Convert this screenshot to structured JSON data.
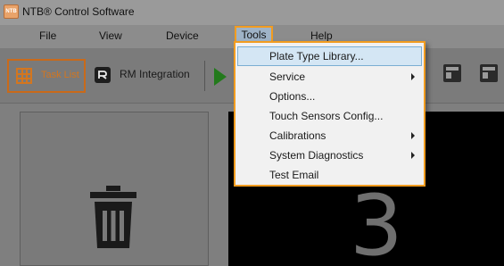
{
  "window": {
    "app_icon_text": "NTB",
    "title": "NTB® Control Software"
  },
  "menubar": {
    "items": [
      {
        "label": "File"
      },
      {
        "label": "View"
      },
      {
        "label": "Device"
      },
      {
        "label": "Tools"
      },
      {
        "label": "Help"
      }
    ]
  },
  "toolbar": {
    "task_list_label": "Task List",
    "rm_integration_label": "RM Integration",
    "icons": {
      "task_list": "grid-icon",
      "rm_integration": "rm-logo-icon",
      "run": "play-icon",
      "window_1": "window-icon",
      "window_2": "window-icon"
    }
  },
  "main": {
    "trash_icon": "trash-icon",
    "display_number": "3"
  },
  "tools_menu": {
    "items": [
      {
        "label": "Plate Type Library...",
        "submenu": false,
        "highlighted": true
      },
      {
        "label": "Service",
        "submenu": true,
        "highlighted": false
      },
      {
        "label": "Options...",
        "submenu": false,
        "highlighted": false
      },
      {
        "label": "Touch Sensors Config...",
        "submenu": false,
        "highlighted": false
      },
      {
        "label": "Calibrations",
        "submenu": true,
        "highlighted": false
      },
      {
        "label": "System Diagnostics",
        "submenu": true,
        "highlighted": false
      },
      {
        "label": "Test Email",
        "submenu": false,
        "highlighted": false
      }
    ]
  },
  "colors": {
    "accent_orange": "#f29c1f",
    "task_list_orange": "#d3761f",
    "run_green": "#237a1c",
    "menu_highlight": "#d4e6f4"
  }
}
